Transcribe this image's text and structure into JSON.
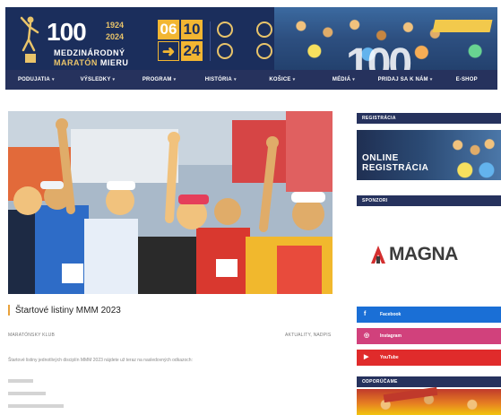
{
  "banner": {
    "hundred": "100",
    "year_start": "1924",
    "year_end": "2024",
    "name_line1": "MEDZINÁRODNÝ",
    "name_line2_a": "MARATÓN",
    "name_line2_b": "MIERU",
    "date_day1": "06",
    "date_day2": "10",
    "date_year": "24",
    "big_number": "100",
    "brand_color": "#1b2e5c",
    "accent_color": "#e9c46a"
  },
  "nav": {
    "items": [
      {
        "label": "PODUJATIA"
      },
      {
        "label": "VÝSLEDKY"
      },
      {
        "label": "PROGRAM"
      },
      {
        "label": "HISTÓRIA"
      },
      {
        "label": "KOŠICE"
      },
      {
        "label": "MÉDIÁ"
      },
      {
        "label": "PRIDAJ SA K NÁM"
      },
      {
        "label": "E-SHOP"
      }
    ],
    "background": "#26325d"
  },
  "article": {
    "title": "Štartové listiny MMM 2023",
    "author": "MARATÓNSKY KLUB",
    "categories": "AKTUALITY, NADPIS",
    "body": "Štartové listiny jednotlivých disciplín MMM 2023 nájdete už teraz na nasledovných odkazoch:",
    "accent_color": "#e9a23b"
  },
  "sidebar": {
    "registration_heading": "REGISTRÁCIA",
    "registration_line1": "ONLINE",
    "registration_line2": "REGISTRÁCIA",
    "sponsors_heading": "SPONZORI",
    "sponsor_name": "MAGNA",
    "social": [
      {
        "label": "Facebook",
        "icon": "facebook-icon",
        "glyph": "f",
        "color": "#1a6fd6"
      },
      {
        "label": "Instagram",
        "icon": "instagram-icon",
        "glyph": "◎",
        "color": "#d1417c"
      },
      {
        "label": "YouTube",
        "icon": "youtube-icon",
        "glyph": "▶",
        "color": "#e02b2b"
      }
    ],
    "recommend_heading": "ODPORÚČAME"
  }
}
